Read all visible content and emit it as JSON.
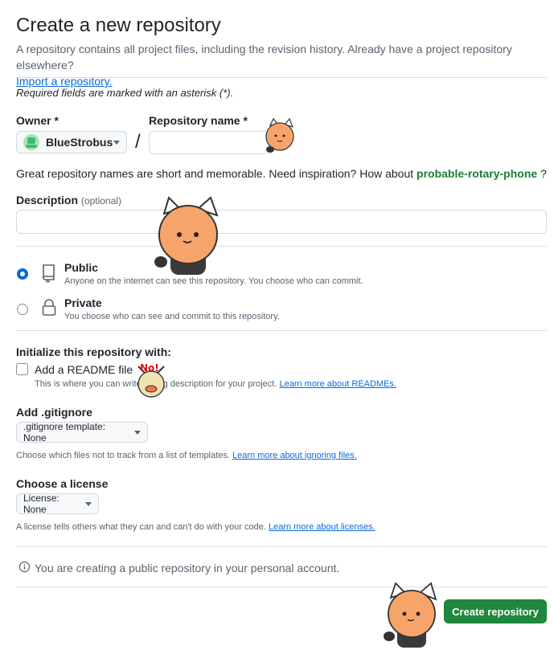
{
  "header": {
    "title": "Create a new repository",
    "subtitle": "A repository contains all project files, including the revision history. Already have a project repository elsewhere?",
    "import_link": "Import a repository."
  },
  "required_note": "Required fields are marked with an asterisk (*).",
  "owner": {
    "label": "Owner *",
    "value": "BlueStrobus"
  },
  "separator": "/",
  "repo_name": {
    "label": "Repository name *",
    "value": ""
  },
  "name_hint": {
    "text": "Great repository names are short and memorable. Need inspiration? How about",
    "suggestion": "probable-rotary-phone",
    "end": "?"
  },
  "description": {
    "label": "Description",
    "optional": "(optional)",
    "value": ""
  },
  "visibility": [
    {
      "label": "Public",
      "desc": "Anyone on the internet can see this repository. You choose who can commit.",
      "checked": true,
      "icon": "repo-icon"
    },
    {
      "label": "Private",
      "desc": "You choose who can see and commit to this repository.",
      "checked": false,
      "icon": "lock-icon"
    }
  ],
  "init": {
    "heading": "Initialize this repository with:",
    "readme_label": "Add a README file",
    "readme_desc": "This is where you can write a long description for your project.",
    "readme_link": "Learn more about READMEs."
  },
  "gitignore": {
    "heading": "Add .gitignore",
    "button": ".gitignore template: None",
    "desc": "Choose which files not to track from a list of templates.",
    "link": "Learn more about ignoring files."
  },
  "license": {
    "heading": "Choose a license",
    "button": "License: None",
    "desc": "A license tells others what they can and can't do with your code.",
    "link": "Learn more about licenses."
  },
  "info": {
    "icon": "info-icon",
    "text": "You are creating a public repository in your personal account."
  },
  "submit": {
    "label": "Create repository"
  },
  "colors": {
    "primary": "#1f883d",
    "link": "#0969da",
    "suggestion": "#1a7f37",
    "radio_checked": "#0969da"
  }
}
